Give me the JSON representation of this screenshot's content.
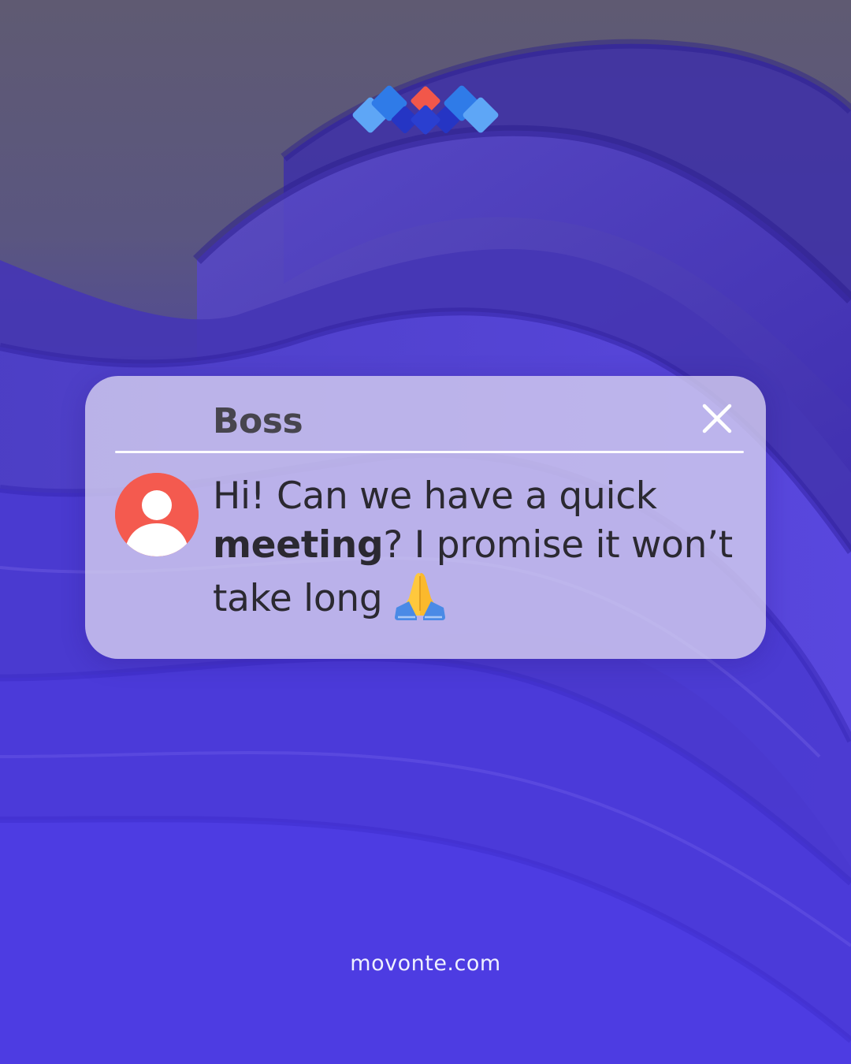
{
  "brand": {
    "logo_icon": "movonte-logo-icon",
    "colors": {
      "light_blue": "#5ea6f6",
      "blue": "#2f7be8",
      "dark_blue": "#2535c4",
      "accent": "#f2574a"
    }
  },
  "notification": {
    "sender": "Boss",
    "message_part1": "Hi! Can we have a quick",
    "message_bold": "meeting",
    "message_part2": "? I promise it won’t take long",
    "emoji_icon": "folded-hands-icon",
    "avatar_icon": "user-avatar-icon",
    "avatar_color": "#f45a4f",
    "close_icon": "close-icon"
  },
  "footer": {
    "url": "movonte.com"
  },
  "background": {
    "top_color": "#5f5a72",
    "bottom_color": "#4a35d6"
  }
}
